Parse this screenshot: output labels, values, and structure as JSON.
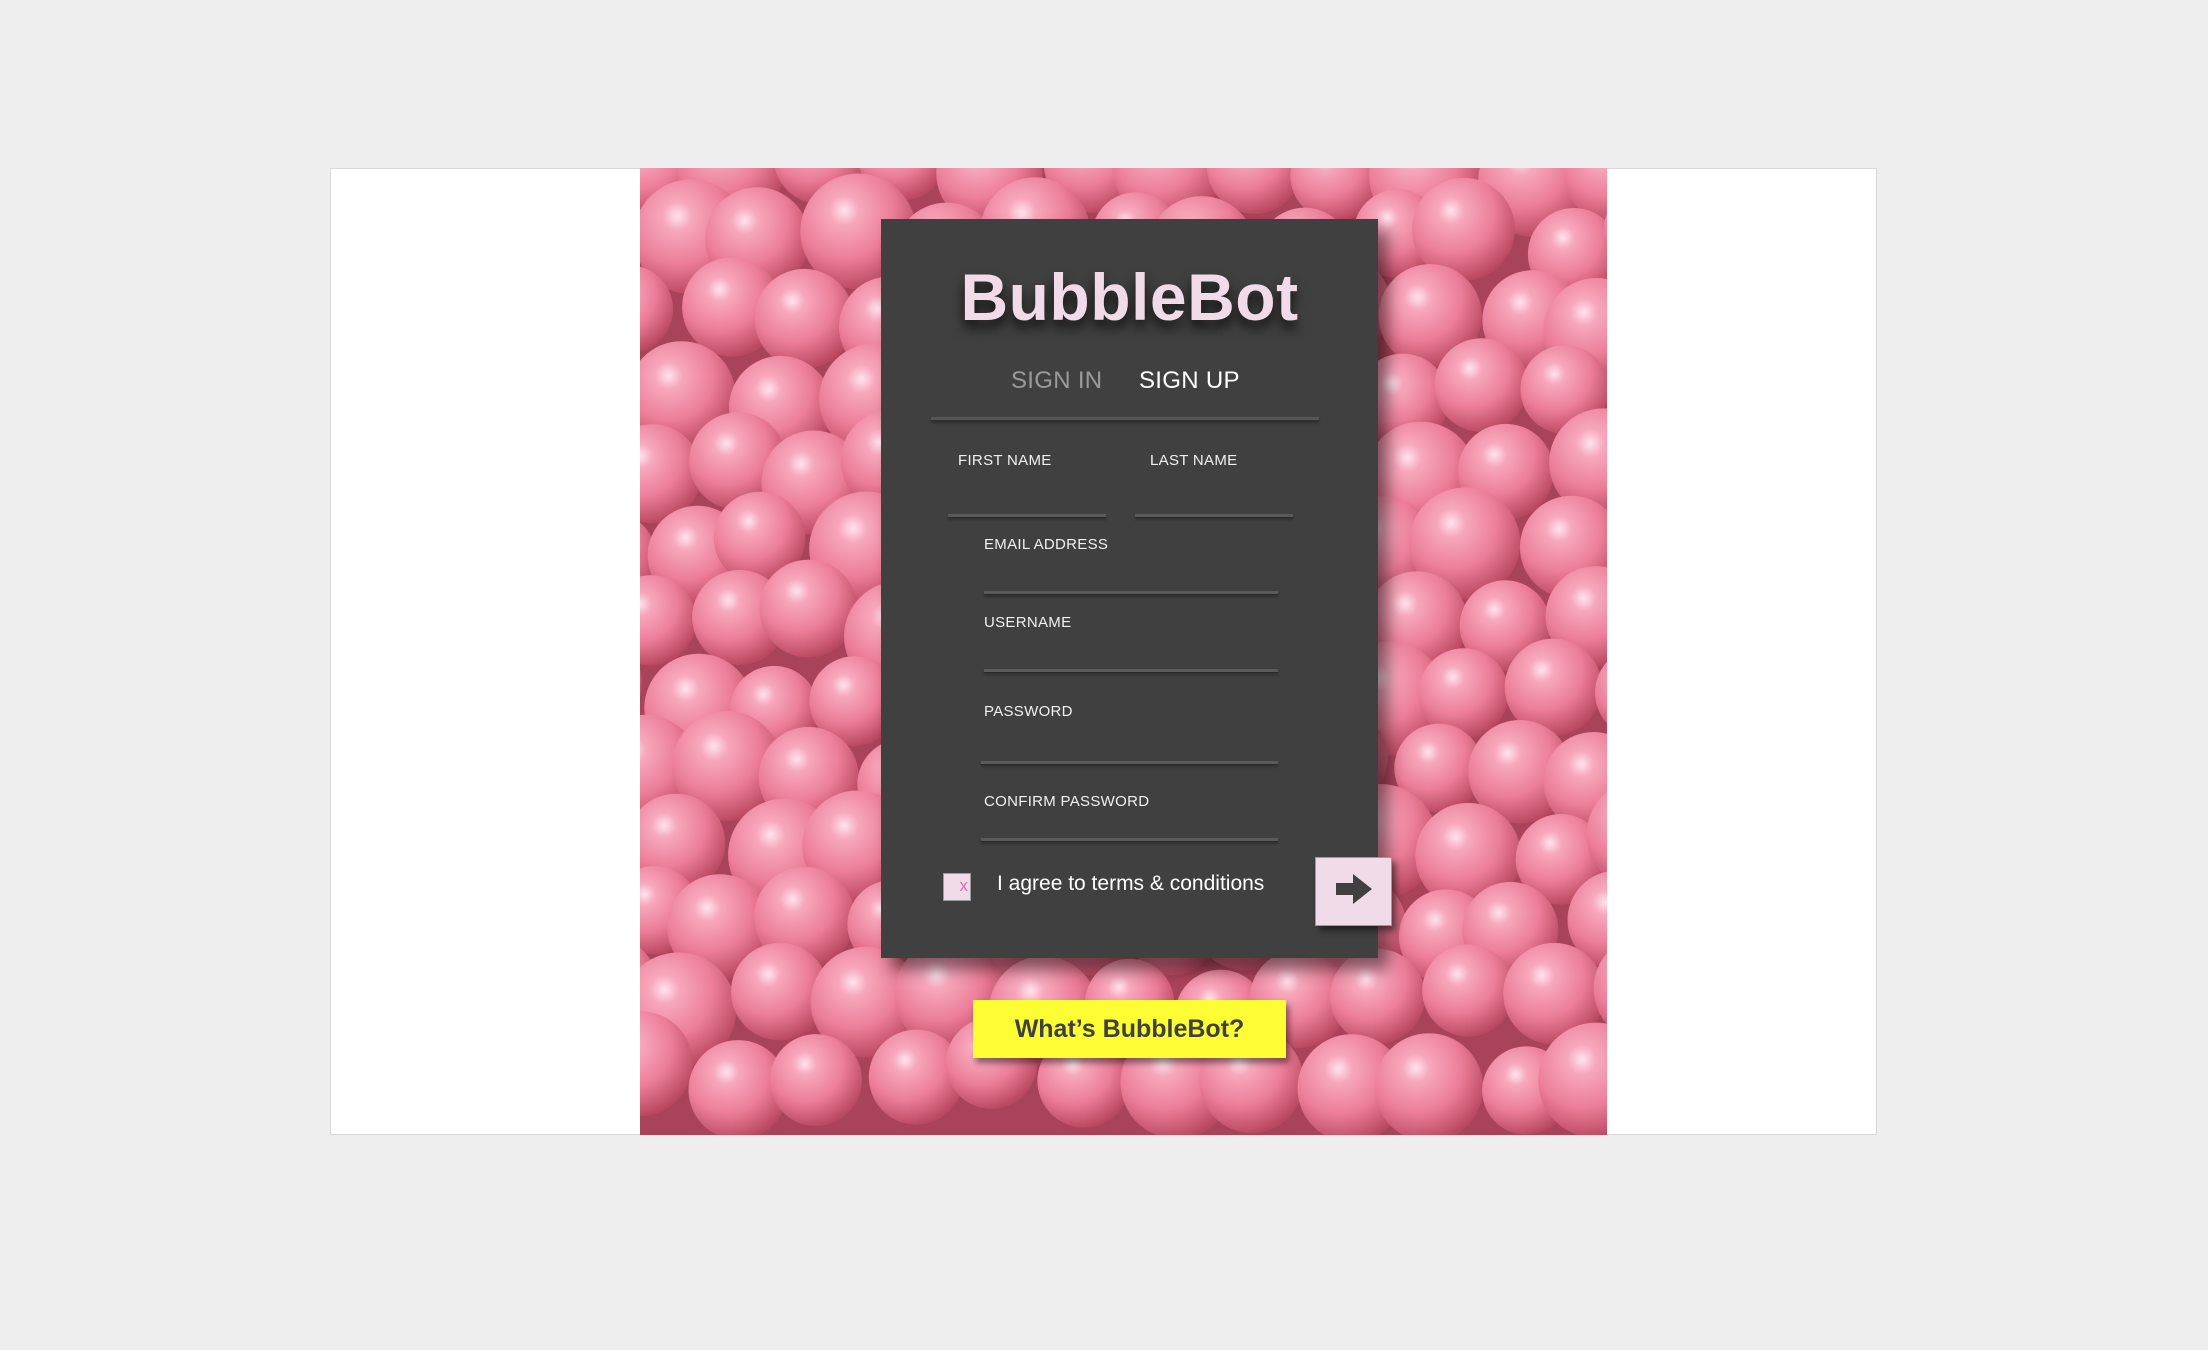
{
  "app": {
    "title": "BubbleBot",
    "accent_color": "#f1dbe9",
    "panel_color": "#404040",
    "background_color": "#d8657f"
  },
  "tabs": {
    "sign_in": "SIGN IN",
    "sign_up": "SIGN UP",
    "active": "SIGN UP"
  },
  "form": {
    "first_name": {
      "label": "FIRST NAME",
      "value": ""
    },
    "last_name": {
      "label": "LAST NAME",
      "value": ""
    },
    "email": {
      "label": "EMAIL ADDRESS",
      "value": ""
    },
    "username": {
      "label": "USERNAME",
      "value": ""
    },
    "password": {
      "label": "PASSWORD",
      "value": ""
    },
    "confirm_password": {
      "label": "CONFIRM PASSWORD",
      "value": ""
    },
    "terms": {
      "label": "I agree to terms & conditions",
      "checked": true,
      "mark": "x"
    },
    "submit_icon": "arrow-right-icon"
  },
  "info_button": {
    "label": "What’s BubbleBot?",
    "color": "#fdfd33"
  }
}
